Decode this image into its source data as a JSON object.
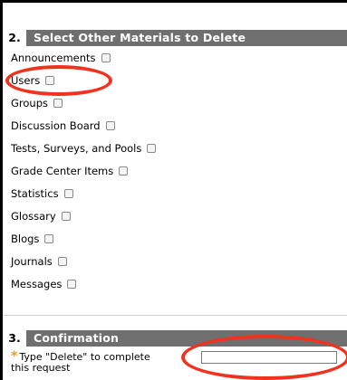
{
  "section2": {
    "number": "2.",
    "title": "Select Other Materials to Delete",
    "items": [
      {
        "label": "Announcements"
      },
      {
        "label": "Users"
      },
      {
        "label": "Groups"
      },
      {
        "label": "Discussion Board"
      },
      {
        "label": "Tests, Surveys, and Pools"
      },
      {
        "label": "Grade Center Items"
      },
      {
        "label": "Statistics"
      },
      {
        "label": "Glossary"
      },
      {
        "label": "Blogs"
      },
      {
        "label": "Journals"
      },
      {
        "label": "Messages"
      }
    ]
  },
  "section3": {
    "number": "3.",
    "title": "Confirmation",
    "required_mark": "*",
    "prompt_line1": "Type \"Delete\" to complete",
    "prompt_line2": "this request",
    "input_value": ""
  },
  "colors": {
    "header_bg": "#6f6f6f",
    "highlight_oval": "#f0321e",
    "required_star": "#f29a00"
  }
}
